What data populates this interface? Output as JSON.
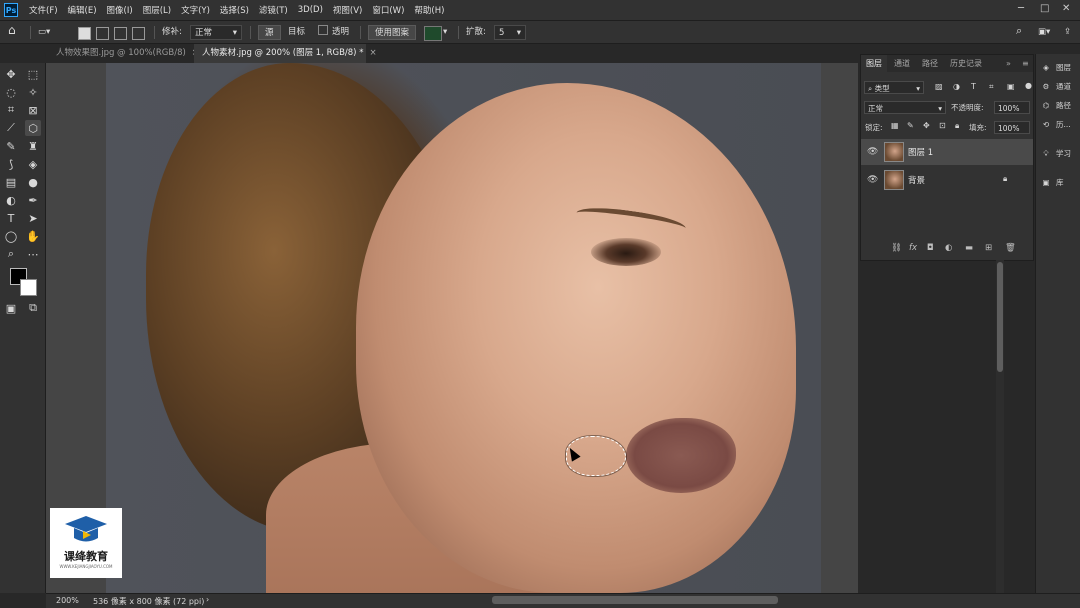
{
  "menubar": {
    "logo": "Ps",
    "items": [
      "文件(F)",
      "编辑(E)",
      "图像(I)",
      "图层(L)",
      "文字(Y)",
      "选择(S)",
      "滤镜(T)",
      "3D(D)",
      "视图(V)",
      "窗口(W)",
      "帮助(H)"
    ],
    "controls": [
      "─",
      "□",
      "✕"
    ]
  },
  "options": {
    "patch_label": "修补:",
    "patch_value": "正常",
    "source_label": "源",
    "target_label": "目标",
    "transparent_label": "透明",
    "use_pattern_label": "使用图案",
    "diffusion_label": "扩散:",
    "diffusion_value": "5"
  },
  "tabs": [
    {
      "label": "人物效果图.jpg @ 100%(RGB/8)",
      "close": "×"
    },
    {
      "label": "人物素材.jpg @ 200% (图层 1, RGB/8) *",
      "close": "×"
    }
  ],
  "layers_panel": {
    "tabs": [
      "图层",
      "通道",
      "路径",
      "历史记录"
    ],
    "filter_kind": "类型",
    "blend_mode": "正常",
    "opacity_label": "不透明度:",
    "opacity_value": "100%",
    "lock_label": "锁定:",
    "fill_label": "填充:",
    "fill_value": "100%",
    "layers": [
      {
        "name": "图层 1",
        "selected": true
      },
      {
        "name": "背景",
        "selected": false,
        "locked": true
      }
    ]
  },
  "right_dock": [
    "图层",
    "通道",
    "路径",
    "历...",
    "学习",
    "库"
  ],
  "status": {
    "zoom": "200%",
    "doc_info": "536 像素 x 800 像素 (72 ppi)"
  },
  "watermark": {
    "title": "课绛教育",
    "subtitle": "WWW.KEJIANGJIAOYU.COM"
  },
  "colors": {
    "foreground": "#000000",
    "background": "#ffffff",
    "ps_blue": "#31a8ff"
  }
}
